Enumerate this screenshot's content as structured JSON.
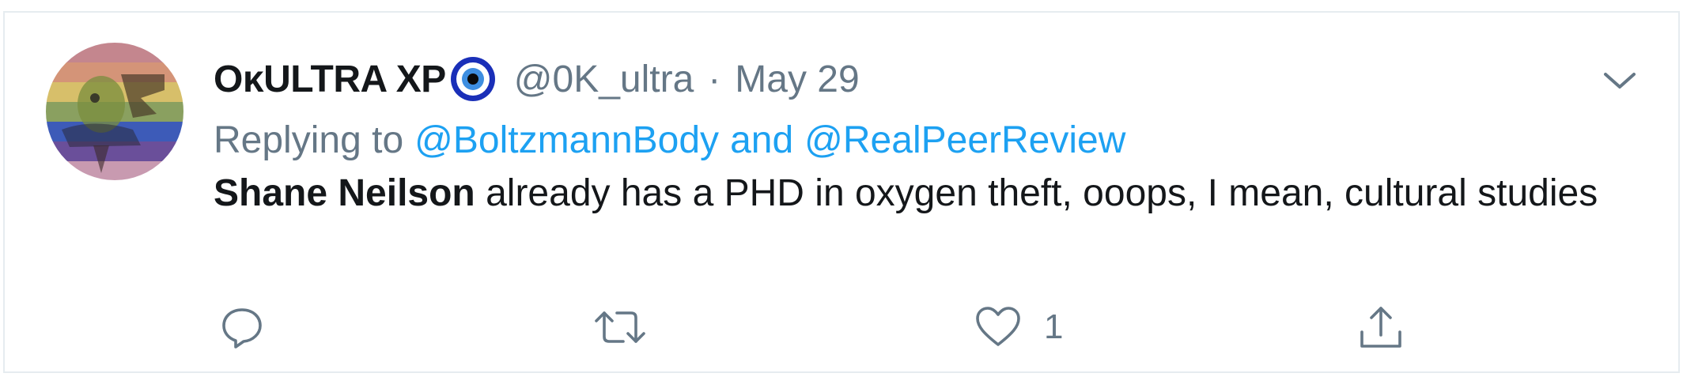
{
  "tweet": {
    "display_name": "OκULTRA XP",
    "verified_icon": "nazar-eye-icon",
    "handle": "@0K_ultra",
    "separator": "·",
    "date": "May 29",
    "replying_label": "Replying to",
    "reply_mention_1": "@BoltzmannBody",
    "reply_and": "and",
    "reply_mention_2": "@RealPeerReview",
    "text_name": "Shane Neilson",
    "text_body": " already has a PHD in oxygen theft, ooops, I mean, cultural studies"
  },
  "actions": {
    "reply": {
      "icon": "reply-icon",
      "count": ""
    },
    "retweet": {
      "icon": "retweet-icon",
      "count": ""
    },
    "like": {
      "icon": "heart-icon",
      "count": "1"
    },
    "share": {
      "icon": "share-icon",
      "count": ""
    }
  },
  "colors": {
    "text_primary": "#14171a",
    "text_secondary": "#657786",
    "link": "#1da1f2",
    "border": "#e6ecf0"
  }
}
